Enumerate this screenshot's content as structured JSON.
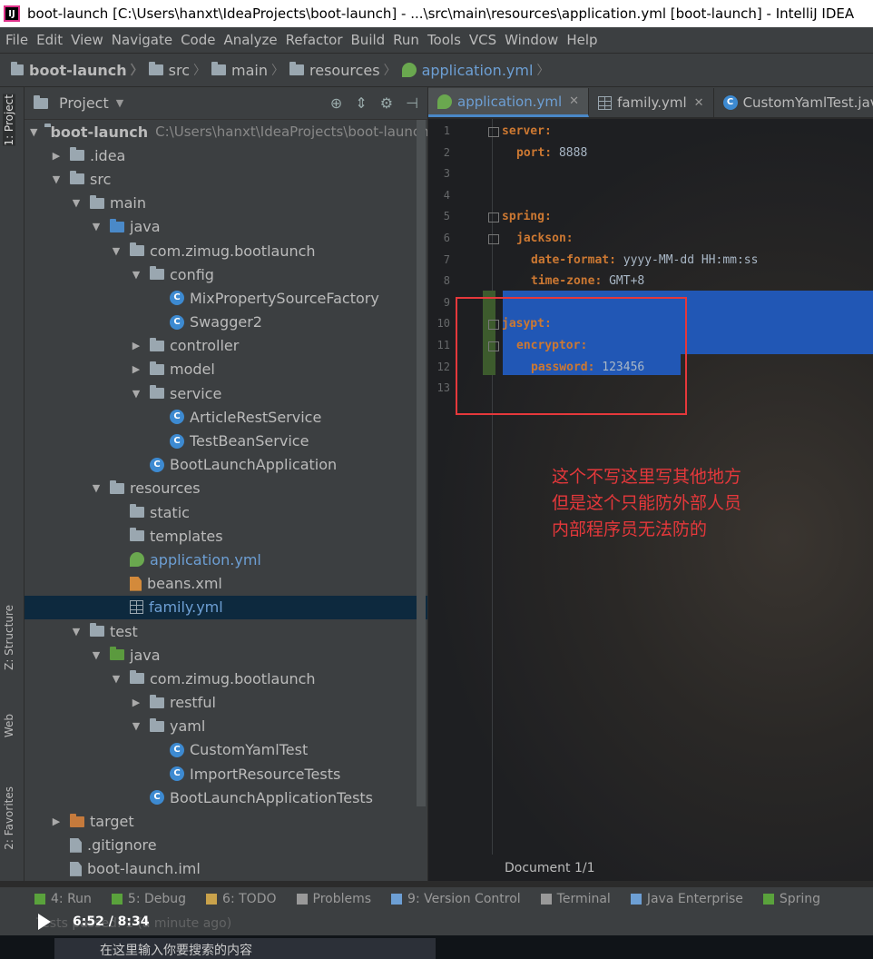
{
  "window": {
    "app_icon_text": "IJ",
    "title": "boot-launch [C:\\Users\\hanxt\\IdeaProjects\\boot-launch] - ...\\src\\main\\resources\\application.yml [boot-launch] - IntelliJ IDEA"
  },
  "menu": [
    {
      "label": "File"
    },
    {
      "label": "Edit"
    },
    {
      "label": "View"
    },
    {
      "label": "Navigate"
    },
    {
      "label": "Code"
    },
    {
      "label": "Analyze"
    },
    {
      "label": "Refactor"
    },
    {
      "label": "Build"
    },
    {
      "label": "Run"
    },
    {
      "label": "Tools"
    },
    {
      "label": "VCS"
    },
    {
      "label": "Window"
    },
    {
      "label": "Help"
    }
  ],
  "breadcrumb": [
    "boot-launch",
    "src",
    "main",
    "resources",
    "application.yml"
  ],
  "left_strip": {
    "project": "1: Project",
    "structure": "Z: Structure",
    "web": "Web",
    "favorites": "2: Favorites"
  },
  "project_panel": {
    "title": "Project",
    "tree": [
      {
        "label": "boot-launch",
        "path": "C:\\Users\\hanxt\\IdeaProjects\\boot-launch",
        "depth": 0,
        "arrow": "open",
        "icon": "folder"
      },
      {
        "label": ".idea",
        "depth": 1,
        "arrow": "closed",
        "icon": "folder"
      },
      {
        "label": "src",
        "depth": 1,
        "arrow": "open",
        "icon": "folder"
      },
      {
        "label": "main",
        "depth": 2,
        "arrow": "open",
        "icon": "folder"
      },
      {
        "label": "java",
        "depth": 3,
        "arrow": "open",
        "icon": "folder-blue"
      },
      {
        "label": "com.zimug.bootlaunch",
        "depth": 4,
        "arrow": "open",
        "icon": "folder"
      },
      {
        "label": "config",
        "depth": 5,
        "arrow": "open",
        "icon": "folder"
      },
      {
        "label": "MixPropertySourceFactory",
        "depth": 6,
        "arrow": "none",
        "icon": "class"
      },
      {
        "label": "Swagger2",
        "depth": 6,
        "arrow": "none",
        "icon": "class"
      },
      {
        "label": "controller",
        "depth": 5,
        "arrow": "closed",
        "icon": "folder"
      },
      {
        "label": "model",
        "depth": 5,
        "arrow": "closed",
        "icon": "folder"
      },
      {
        "label": "service",
        "depth": 5,
        "arrow": "open",
        "icon": "folder"
      },
      {
        "label": "ArticleRestService",
        "depth": 6,
        "arrow": "none",
        "icon": "class"
      },
      {
        "label": "TestBeanService",
        "depth": 6,
        "arrow": "none",
        "icon": "class"
      },
      {
        "label": "BootLaunchApplication",
        "depth": 5,
        "arrow": "none",
        "icon": "class"
      },
      {
        "label": "resources",
        "depth": 3,
        "arrow": "open",
        "icon": "folder-res"
      },
      {
        "label": "static",
        "depth": 4,
        "arrow": "none",
        "icon": "folder"
      },
      {
        "label": "templates",
        "depth": 4,
        "arrow": "none",
        "icon": "folder"
      },
      {
        "label": "application.yml",
        "depth": 4,
        "arrow": "none",
        "icon": "spring"
      },
      {
        "label": "beans.xml",
        "depth": 4,
        "arrow": "none",
        "icon": "xml"
      },
      {
        "label": "family.yml",
        "depth": 4,
        "arrow": "none",
        "icon": "table",
        "selected": true
      },
      {
        "label": "test",
        "depth": 2,
        "arrow": "open",
        "icon": "folder"
      },
      {
        "label": "java",
        "depth": 3,
        "arrow": "open",
        "icon": "folder-green"
      },
      {
        "label": "com.zimug.bootlaunch",
        "depth": 4,
        "arrow": "open",
        "icon": "folder"
      },
      {
        "label": "restful",
        "depth": 5,
        "arrow": "closed",
        "icon": "folder"
      },
      {
        "label": "yaml",
        "depth": 5,
        "arrow": "open",
        "icon": "folder"
      },
      {
        "label": "CustomYamlTest",
        "depth": 6,
        "arrow": "none",
        "icon": "class"
      },
      {
        "label": "ImportResourceTests",
        "depth": 6,
        "arrow": "none",
        "icon": "class"
      },
      {
        "label": "BootLaunchApplicationTests",
        "depth": 5,
        "arrow": "none",
        "icon": "class"
      },
      {
        "label": "target",
        "depth": 1,
        "arrow": "closed",
        "icon": "folder-orange"
      },
      {
        "label": ".gitignore",
        "depth": 1,
        "arrow": "none",
        "icon": "file"
      },
      {
        "label": "boot-launch.iml",
        "depth": 1,
        "arrow": "none",
        "icon": "file"
      }
    ]
  },
  "editor_tabs": [
    {
      "label": "application.yml",
      "active": true,
      "icon": "spring"
    },
    {
      "label": "family.yml",
      "active": false,
      "icon": "table"
    },
    {
      "label": "CustomYamlTest.java",
      "active": false,
      "icon": "class"
    }
  ],
  "editor": {
    "lines": [
      {
        "n": "1",
        "key": "server:",
        "val": "",
        "indent": 0
      },
      {
        "n": "2",
        "key": "port:",
        "val": " 8888",
        "indent": 1
      },
      {
        "n": "3",
        "key": "",
        "val": "",
        "indent": 0
      },
      {
        "n": "4",
        "key": "",
        "val": "",
        "indent": 0
      },
      {
        "n": "5",
        "key": "spring:",
        "val": "",
        "indent": 0
      },
      {
        "n": "6",
        "key": "jackson:",
        "val": "",
        "indent": 1
      },
      {
        "n": "7",
        "key": "date-format:",
        "val": " yyyy-MM-dd HH:mm:ss",
        "indent": 2
      },
      {
        "n": "8",
        "key": "time-zone:",
        "val": " GMT+8",
        "indent": 2
      },
      {
        "n": "9",
        "key": "",
        "val": "",
        "indent": 0
      },
      {
        "n": "10",
        "key": "jasypt:",
        "val": "",
        "indent": 0
      },
      {
        "n": "11",
        "key": "encryptor:",
        "val": "",
        "indent": 1
      },
      {
        "n": "12",
        "key": "password:",
        "val": " 123456",
        "indent": 2
      },
      {
        "n": "13",
        "key": "",
        "val": "",
        "indent": 0
      }
    ],
    "annotation": "这个不写这里写其他地方\n但是这个只能防外部人员\n内部程序员无法防的",
    "status": "Document 1/1"
  },
  "bottom_tools": [
    {
      "label": "4: Run",
      "color": "#5aa23c"
    },
    {
      "label": "5: Debug",
      "color": "#5aa23c"
    },
    {
      "label": "6: TODO",
      "color": "#c9a24b"
    },
    {
      "label": "Problems",
      "color": "#999999"
    },
    {
      "label": "9: Version Control",
      "color": "#6d9fd4"
    },
    {
      "label": "Terminal",
      "color": "#999999"
    },
    {
      "label": "Java Enterprise",
      "color": "#6d9fd4"
    },
    {
      "label": "Spring",
      "color": "#5aa23c"
    }
  ],
  "statusbar": {
    "text": "Tests passed: 1 (a minute ago)",
    "video_time": "6:52 / 8:34"
  },
  "taskbar": {
    "search_placeholder": "在这里输入你要搜索的内容"
  }
}
